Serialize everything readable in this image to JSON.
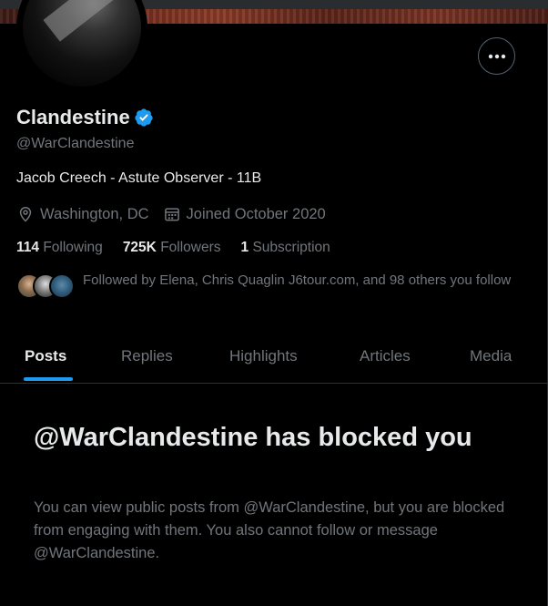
{
  "profile": {
    "display_name": "Clandestine",
    "verified": true,
    "handle": "@WarClandestine",
    "bio": "Jacob Creech - Astute Observer - 11B",
    "location": "Washington, DC",
    "joined": "Joined October 2020"
  },
  "stats": {
    "following_count": "114",
    "following_label": "Following",
    "followers_count": "725K",
    "followers_label": "Followers",
    "subscription_count": "1",
    "subscription_label": "Subscription"
  },
  "followed_by": {
    "text": "Followed by Elena, Chris Quaglin J6tour.com, and 98 others you follow"
  },
  "tabs": [
    {
      "label": "Posts",
      "active": true
    },
    {
      "label": "Replies",
      "active": false
    },
    {
      "label": "Highlights",
      "active": false
    },
    {
      "label": "Articles",
      "active": false
    },
    {
      "label": "Media",
      "active": false
    }
  ],
  "blocked": {
    "title": "@WarClandestine has blocked you",
    "description": "You can view public posts from @WarClandestine, but you are blocked from engaging with them. You also cannot follow or message @WarClandestine."
  },
  "colors": {
    "accent": "#1d9bf0",
    "muted_text": "#71767b",
    "primary_text": "#e7e9ea",
    "background": "#000000"
  },
  "icons": [
    "more-icon",
    "verified-badge-icon",
    "location-icon",
    "calendar-icon"
  ]
}
